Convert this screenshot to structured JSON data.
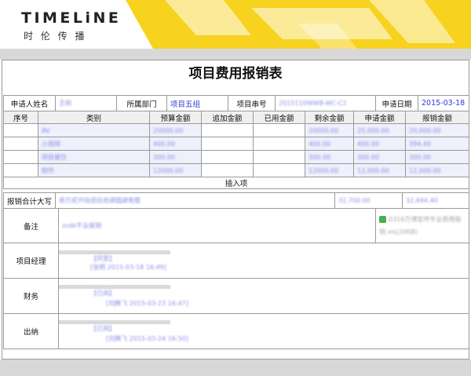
{
  "brand": {
    "logo_text": "TIMELiNE",
    "logo_sub": "时 伦 传 播"
  },
  "colors": {
    "banner_yellow": "#f7d21e",
    "band_gray": "#d8d8d8",
    "link_blue": "#2f3bd6"
  },
  "form": {
    "title": "项目费用报销表",
    "applicant_label": "申请人姓名",
    "applicant_value": "王刚",
    "dept_label": "所属部门",
    "dept_value": "项目五组",
    "project_no_label": "项目串号",
    "project_no_value": "2015110WWB-WC-C2",
    "apply_date_label": "申请日期",
    "apply_date_value": "2015-03-18"
  },
  "table": {
    "headers": [
      "序号",
      "类别",
      "预算金额",
      "追加金额",
      "已用金额",
      "剩余金额",
      "申请金额",
      "报销金额"
    ],
    "rows": [
      {
        "no": "",
        "category": "AV",
        "budget": "20000.00",
        "added": "",
        "used": "",
        "remaining": "20000.00",
        "applied": "20,000.00",
        "reimbursed": "20,000.00"
      },
      {
        "no": "",
        "category": "小视频",
        "budget": "400.00",
        "added": "",
        "used": "",
        "remaining": "400.00",
        "applied": "400.00",
        "reimbursed": "394.40"
      },
      {
        "no": "",
        "category": "项目餐饮",
        "budget": "300.00",
        "added": "",
        "used": "",
        "remaining": "300.00",
        "applied": "300.00",
        "reimbursed": "300.00"
      },
      {
        "no": "",
        "category": "制作",
        "budget": "12000.00",
        "added": "",
        "used": "",
        "remaining": "12000.00",
        "applied": "12,000.00",
        "reimbursed": "12,000.00"
      }
    ],
    "insert_label": "插入项"
  },
  "summary": {
    "label": "报销合计大写",
    "value_text": "叁万贰仟陆佰玖拾肆圆肆角整",
    "applied_total": "32,700.00",
    "reimbursed_total": "32,694.40"
  },
  "note": {
    "label": "备注",
    "value": "zsdk牛业报销",
    "attachment": "0316万博宣传牛业费用报销.xls(20KB)"
  },
  "approvals": [
    {
      "label": "项目经理",
      "status": "【同意】",
      "action": "[张明 2015-03-18 16:49]"
    },
    {
      "label": "财务",
      "status": "【已阅】",
      "action": "[刘腾飞 2015-03-23 16:47]"
    },
    {
      "label": "出纳",
      "status": "【已阅】",
      "action": "[刘腾飞 2015-03-24 16:50]"
    }
  ]
}
